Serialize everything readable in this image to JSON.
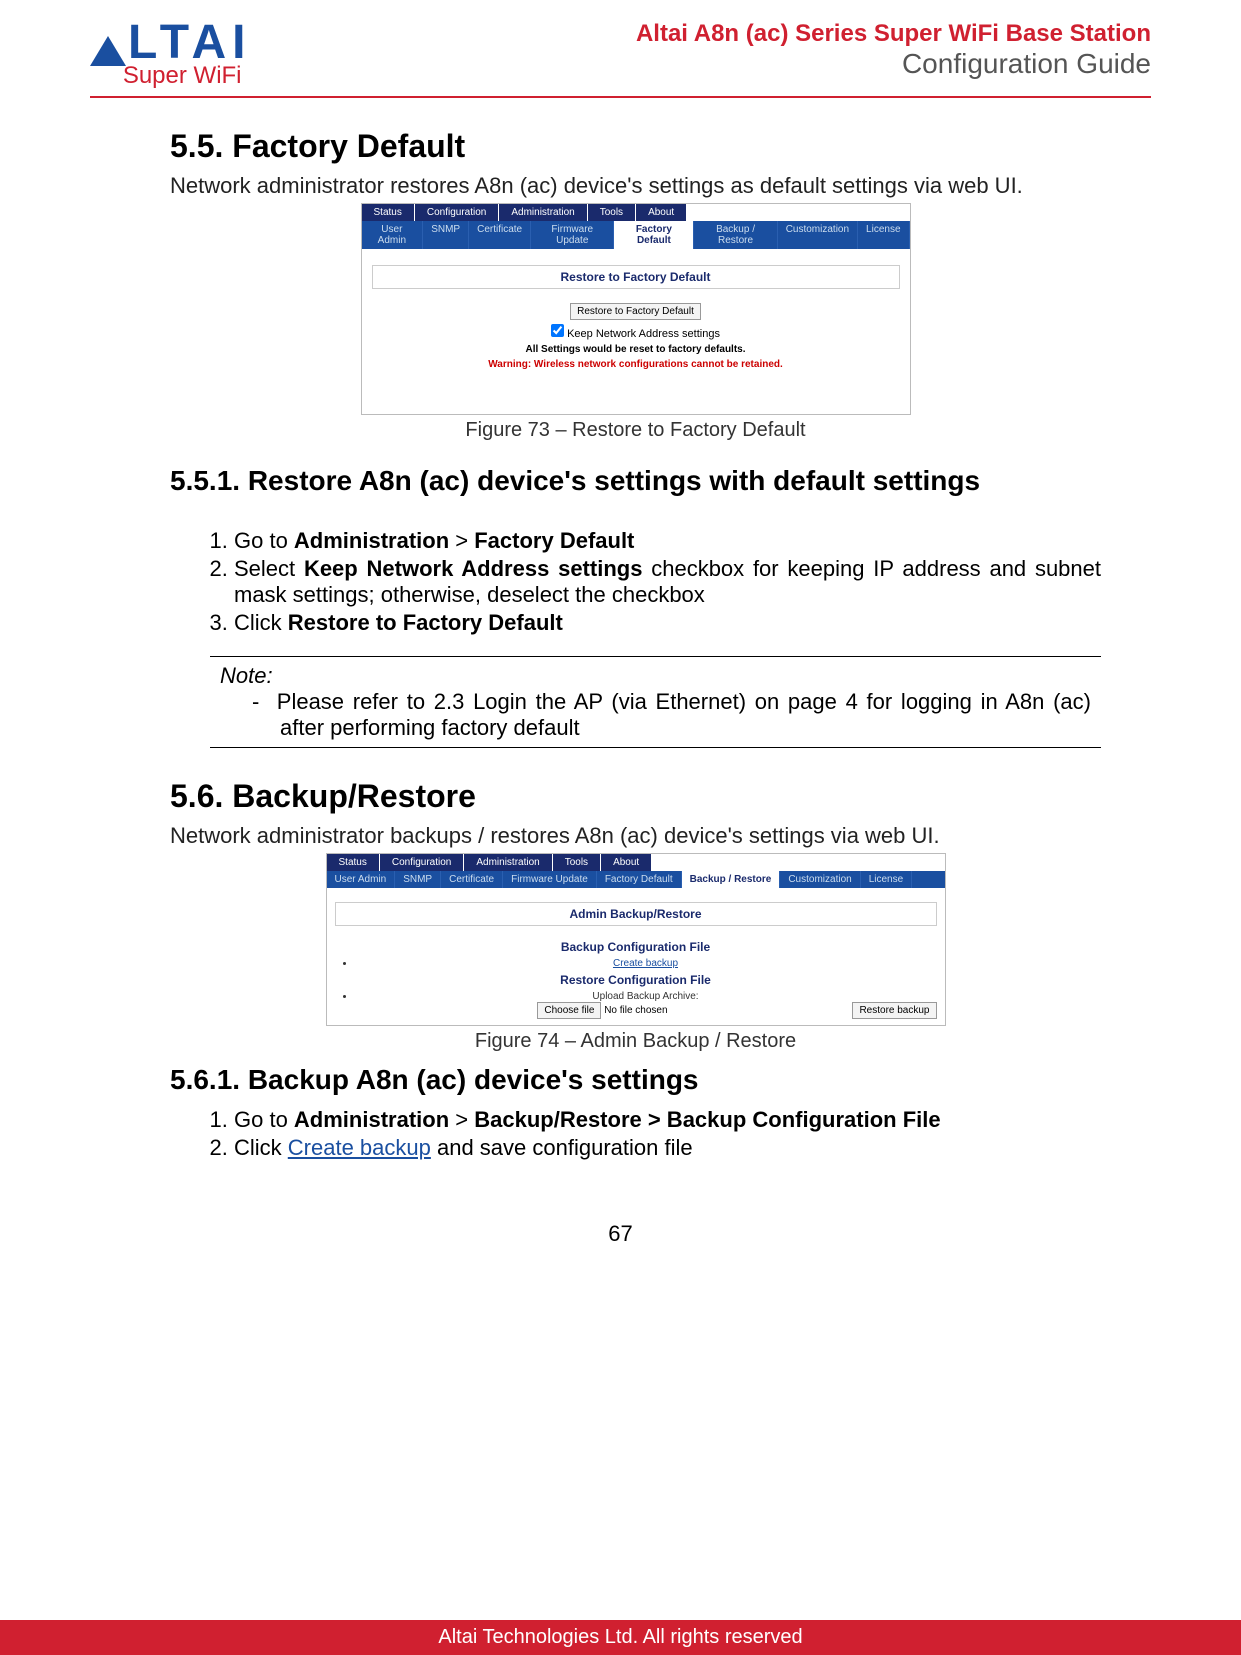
{
  "header": {
    "logo_text": "LTAI",
    "logo_sub": "Super WiFi",
    "title_line1": "Altai A8n (ac) Series Super WiFi Base Station",
    "title_line2": "Configuration Guide"
  },
  "section_5_5": {
    "heading": "5.5.  Factory Default",
    "intro": "Network administrator restores A8n (ac) device's settings as default settings via web UI.",
    "fig_caption": "Figure 73 – Restore to Factory Default",
    "screenshot": {
      "top_tabs": [
        "Status",
        "Configuration",
        "Administration",
        "Tools",
        "About"
      ],
      "sub_tabs": [
        "User Admin",
        "SNMP",
        "Certificate",
        "Firmware Update",
        "Factory Default",
        "Backup / Restore",
        "Customization",
        "License"
      ],
      "active_sub": "Factory Default",
      "panel_title": "Restore to Factory Default",
      "button": "Restore to Factory Default",
      "checkbox": "Keep Network Address settings",
      "line_bold": "All Settings would be reset to factory defaults.",
      "line_warn": "Warning: Wireless network configurations cannot be retained."
    },
    "sub_heading": "5.5.1.    Restore A8n (ac) device's settings with default settings",
    "steps": {
      "s1_a": "Go to ",
      "s1_b": "Administration",
      "s1_c": " > ",
      "s1_d": "Factory Default",
      "s2_a": "Select ",
      "s2_b": "Keep Network Address settings",
      "s2_c": " checkbox for keeping IP address and subnet mask settings; otherwise, deselect the checkbox",
      "s3_a": "Click ",
      "s3_b": "Restore to Factory Default"
    },
    "note_title": "Note:",
    "note_body": "Please refer to 2.3 Login the AP (via Ethernet) on page 4 for logging in A8n (ac) after performing factory default"
  },
  "section_5_6": {
    "heading": "5.6.  Backup/Restore",
    "intro": "Network administrator backups / restores A8n (ac) device's settings via web UI.",
    "fig_caption": "Figure 74 – Admin Backup / Restore",
    "screenshot": {
      "top_tabs": [
        "Status",
        "Configuration",
        "Administration",
        "Tools",
        "About"
      ],
      "sub_tabs": [
        "User Admin",
        "SNMP",
        "Certificate",
        "Firmware Update",
        "Factory Default",
        "Backup / Restore",
        "Customization",
        "License"
      ],
      "active_sub": "Backup / Restore",
      "panel_title": "Admin Backup/Restore",
      "backup_h": "Backup Configuration File",
      "backup_link": "Create backup",
      "restore_h": "Restore Configuration File",
      "restore_label": "Upload Backup Archive:",
      "choose_btn": "Choose file",
      "choose_text": "No file chosen",
      "restore_btn": "Restore backup"
    },
    "sub_heading": "5.6.1.    Backup A8n (ac) device's settings",
    "steps": {
      "s1_a": "Go to ",
      "s1_b": "Administration",
      "s1_c": " > ",
      "s1_d": "Backup/Restore > Backup Configuration File",
      "s2_a": "Click ",
      "s2_link": "Create backup",
      "s2_c": " and save configuration file"
    }
  },
  "footer": {
    "page_num": "67",
    "bar": "Altai Technologies Ltd. All rights reserved"
  }
}
